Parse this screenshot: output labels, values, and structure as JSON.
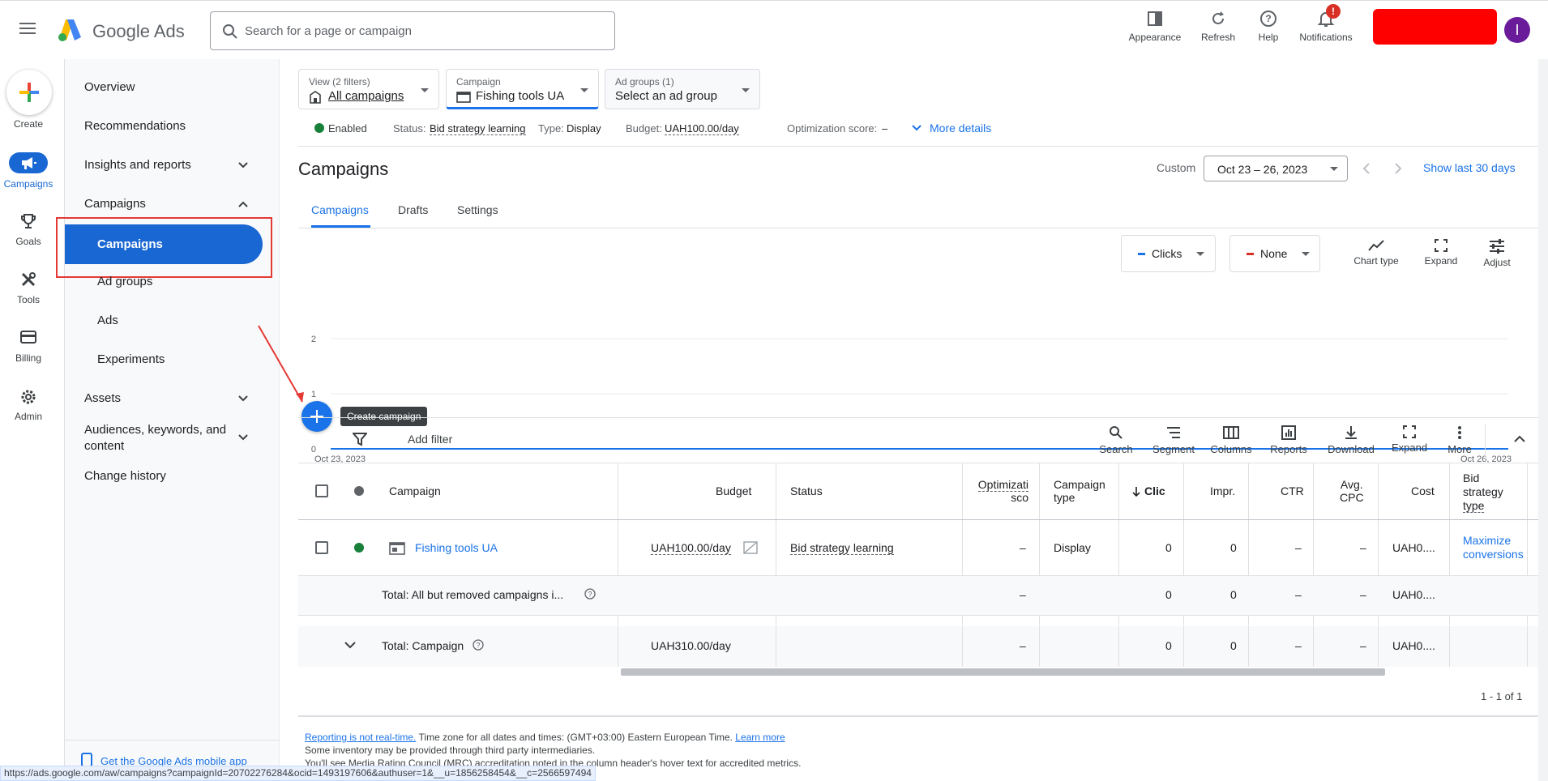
{
  "header": {
    "brand": "Google Ads",
    "search_placeholder": "Search for a page or campaign",
    "actions": [
      {
        "label": "Appearance",
        "icon": "appearance-icon"
      },
      {
        "label": "Refresh",
        "icon": "refresh-icon"
      },
      {
        "label": "Help",
        "icon": "help-icon"
      },
      {
        "label": "Notifications",
        "icon": "bell-icon",
        "badge": "!"
      }
    ],
    "avatar_letter": "I",
    "redacted_color": "#ff0000"
  },
  "rail": {
    "create": "Create",
    "items": [
      {
        "label": "Campaigns",
        "icon": "megaphone-icon"
      },
      {
        "label": "Goals",
        "icon": "trophy-icon"
      },
      {
        "label": "Tools",
        "icon": "tools-icon"
      },
      {
        "label": "Billing",
        "icon": "credit-card-icon"
      },
      {
        "label": "Admin",
        "icon": "gear-icon"
      }
    ]
  },
  "nav": {
    "overview": "Overview",
    "recommendations": "Recommendations",
    "insights": "Insights and reports",
    "campaigns_group": "Campaigns",
    "campaigns": "Campaigns",
    "ad_groups": "Ad groups",
    "ads": "Ads",
    "experiments": "Experiments",
    "assets": "Assets",
    "audiences": "Audiences, keywords, and content",
    "change_history": "Change history",
    "mobile_app": "Get the Google Ads mobile app"
  },
  "filters": {
    "view_label": "View (2 filters)",
    "view_value": "All campaigns",
    "campaign_label": "Campaign",
    "campaign_value": "Fishing tools UA",
    "adgroups_label": "Ad groups (1)",
    "adgroups_value": "Select an ad group"
  },
  "status_bar": {
    "enabled": "Enabled",
    "status_label": "Status:",
    "status_value": "Bid strategy learning",
    "type_label": "Type:",
    "type_value": "Display",
    "budget_label": "Budget:",
    "budget_value": "UAH100.00/day",
    "opt_label": "Optimization score:",
    "opt_value": "–",
    "more_details": "More details"
  },
  "page": {
    "title": "Campaigns",
    "date_prefix": "Custom",
    "date_range": "Oct 23 – 26, 2023",
    "show_last": "Show last 30 days",
    "tabs": [
      "Campaigns",
      "Drafts",
      "Settings"
    ]
  },
  "chart_controls": {
    "metric1": "Clicks",
    "metric1_color": "#1a73e8",
    "metric2": "None",
    "metric2_color": "#d93025",
    "chart_type": "Chart type",
    "expand": "Expand",
    "adjust": "Adjust"
  },
  "chart_data": {
    "type": "line",
    "x": [
      "Oct 23, 2023",
      "Oct 24, 2023",
      "Oct 25, 2023",
      "Oct 26, 2023"
    ],
    "series": [
      {
        "name": "Clicks",
        "values": [
          0,
          0,
          0,
          0
        ]
      }
    ],
    "x_tick_labels": [
      "Oct 23, 2023",
      "Oct 26, 2023"
    ],
    "y_tick_labels": [
      "2",
      "1",
      "0"
    ],
    "ylim": [
      0,
      2
    ],
    "grid": true
  },
  "fab_tooltip": "Create campaign",
  "toolbar": {
    "add_filter": "Add filter",
    "tools": [
      {
        "label": "Search",
        "icon": "search-icon"
      },
      {
        "label": "Segment",
        "icon": "segment-icon"
      },
      {
        "label": "Columns",
        "icon": "columns-icon"
      },
      {
        "label": "Reports",
        "icon": "reports-icon"
      },
      {
        "label": "Download",
        "icon": "download-icon"
      },
      {
        "label": "Expand",
        "icon": "expand-icon"
      },
      {
        "label": "More",
        "icon": "more-vert-icon"
      }
    ]
  },
  "table": {
    "headers": {
      "campaign": "Campaign",
      "budget": "Budget",
      "status": "Status",
      "opt_line1": "Optimizati",
      "opt_line2": "sco",
      "type_line1": "Campaign",
      "type_line2": "type",
      "clicks": "Clic",
      "impr": "Impr.",
      "ctr": "CTR",
      "cpc_line1": "Avg.",
      "cpc_line2": "CPC",
      "cost": "Cost",
      "bid_line1": "Bid",
      "bid_line2": "strategy",
      "bid_line3": "type"
    },
    "row": {
      "campaign": "Fishing tools UA",
      "budget": "UAH100.00/day",
      "status": "Bid strategy learning",
      "opt": "–",
      "type": "Display",
      "clicks": "0",
      "impr": "0",
      "ctr": "–",
      "cpc": "–",
      "cost": "UAH0....",
      "bid_line1": "Maximize",
      "bid_line2": "conversions"
    },
    "total1": {
      "label": "Total: All but removed campaigns i...",
      "opt": "–",
      "clicks": "0",
      "impr": "0",
      "ctr": "–",
      "cpc": "–",
      "cost": "UAH0...."
    },
    "total2": {
      "label": "Total: Campaign",
      "budget": "UAH310.00/day",
      "opt": "–",
      "clicks": "0",
      "impr": "0",
      "ctr": "–",
      "cpc": "–",
      "cost": "UAH0...."
    },
    "pagination": "1 - 1 of 1"
  },
  "footer": {
    "realtime_link": "Reporting is not real-time.",
    "timezone": "Time zone for all dates and times: (GMT+03:00) Eastern European Time.",
    "learn_more": "Learn more",
    "line2": "Some inventory may be provided through third party intermediaries.",
    "line3": "You'll see Media Rating Council (MRC) accreditation noted in the column header's hover text for accredited metrics."
  },
  "statusbar_url": "https://ads.google.com/aw/campaigns?campaignId=20702276284&ocid=1493197606&authuser=1&__u=1856258454&__c=2566597494"
}
